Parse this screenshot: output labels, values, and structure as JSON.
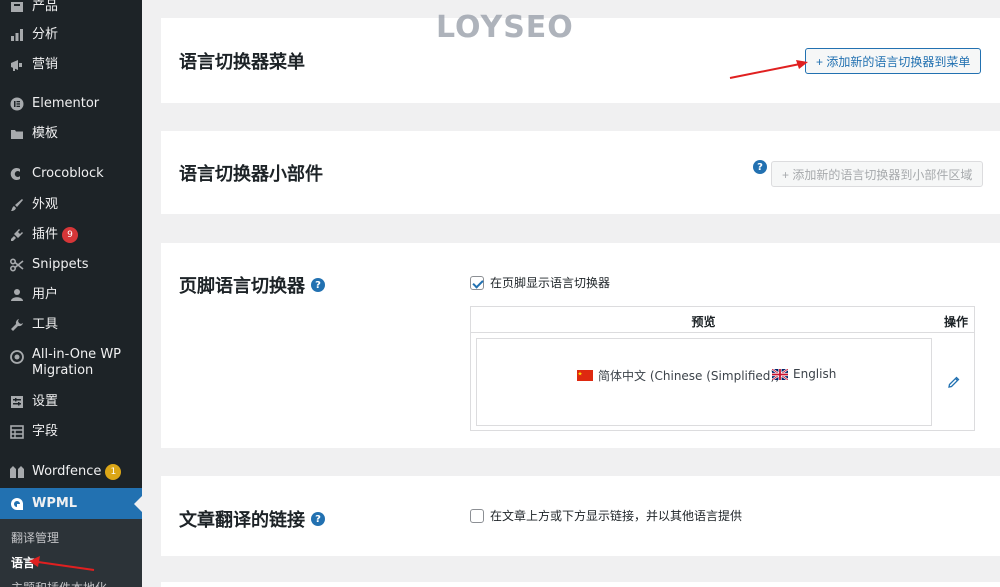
{
  "sidebar": {
    "items": [
      {
        "label": "产品",
        "icon": "archive-icon"
      },
      {
        "label": "分析",
        "icon": "bar-chart-icon"
      },
      {
        "label": "营销",
        "icon": "megaphone-icon"
      },
      {
        "label": "Elementor",
        "icon": "elementor-icon"
      },
      {
        "label": "模板",
        "icon": "folder-icon"
      },
      {
        "label": "Crocoblock",
        "icon": "crocoblock-icon"
      },
      {
        "label": "外观",
        "icon": "paintbrush-icon"
      },
      {
        "label": "插件",
        "icon": "plugin-icon",
        "badge": "9"
      },
      {
        "label": "Snippets",
        "icon": "scissors-icon"
      },
      {
        "label": "用户",
        "icon": "user-icon"
      },
      {
        "label": "工具",
        "icon": "wrench-icon"
      },
      {
        "label": "All-in-One WP Migration",
        "icon": "migration-icon"
      },
      {
        "label": "设置",
        "icon": "settings-icon"
      },
      {
        "label": "字段",
        "icon": "table-icon"
      },
      {
        "label": "Wordfence",
        "icon": "wordfence-icon",
        "badge": "1"
      },
      {
        "label": "WPML",
        "icon": "wpml-icon"
      }
    ],
    "allinone_line1": "All-in-One WP",
    "allinone_line2": "Migration",
    "submenu": [
      {
        "label": "翻译管理"
      },
      {
        "label": "语言"
      },
      {
        "label": "主题和插件本地化"
      }
    ]
  },
  "watermark": "LOYSEO",
  "menu_switcher": {
    "title": "语言切换器菜单",
    "button": "+ 添加新的语言切换器到菜单"
  },
  "widget_switcher": {
    "title": "语言切换器小部件",
    "help": "?",
    "button": "+ 添加新的语言切换器到小部件区域"
  },
  "footer_switcher": {
    "title": "页脚语言切换器",
    "help": "?",
    "checkbox_label": "在页脚显示语言切换器",
    "checked": true,
    "table_header_preview": "预览",
    "table_header_actions": "操作",
    "languages": [
      "简体中文 (Chinese (Simplified))",
      "English"
    ]
  },
  "post_links": {
    "title": "文章翻译的链接",
    "help": "?",
    "checkbox_label": "在文章上方或下方显示链接，并以其他语言提供",
    "checked": false
  },
  "colors": {
    "sidebar_bg": "#1d2327",
    "accent": "#2271b1",
    "badge_red": "#d63638",
    "badge_orange": "#dba617",
    "annotation_red": "#e02020"
  }
}
